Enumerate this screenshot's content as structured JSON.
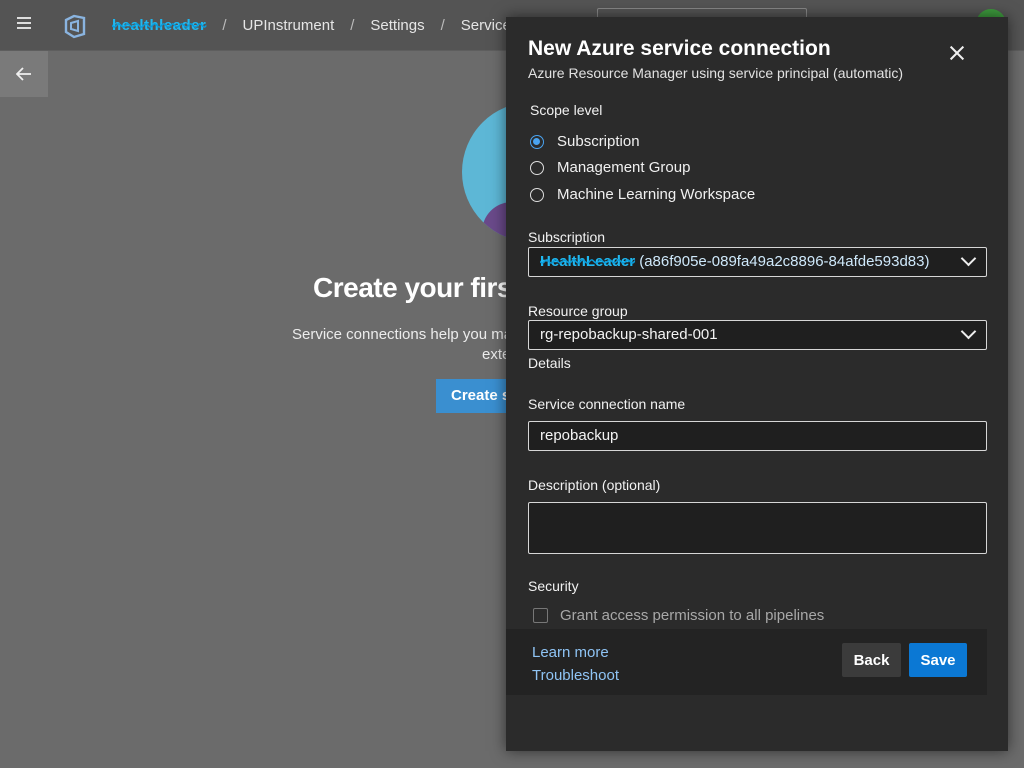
{
  "topbar": {
    "org": "healthleader",
    "project": "UPInstrument",
    "settings": "Settings",
    "service_crumb": "Service c"
  },
  "background": {
    "title": "Create your firs",
    "desc_line1": "Service connections help you mar",
    "desc_line2": "exte",
    "create_button": "Create s"
  },
  "panel": {
    "title": "New Azure service connection",
    "subtitle": "Azure Resource Manager using service principal (automatic)",
    "scope_label": "Scope level",
    "scope_options": [
      "Subscription",
      "Management Group",
      "Machine Learning Workspace"
    ],
    "scope_selected": "Subscription",
    "subscription_label": "Subscription",
    "subscription_name": "HealthLeader",
    "subscription_id": "(a86f905e-089fa49a2c8896-84afde593d83)",
    "resource_group_label": "Resource group",
    "resource_group_value": "rg-repobackup-shared-001",
    "details_label": "Details",
    "connection_name_label": "Service connection name",
    "connection_name_value": "repobackup",
    "description_label": "Description (optional)",
    "description_value": "",
    "security_label": "Security",
    "grant_access_label": "Grant access permission to all pipelines",
    "grant_access_checked": false,
    "learn_more": "Learn more",
    "troubleshoot": "Troubleshoot",
    "back_button": "Back",
    "save_button": "Save"
  },
  "colors": {
    "accent": "#0b78d4",
    "link": "#8fc4f5",
    "panel_bg": "#2b2b2b",
    "overlay_bg": "#6b6b6b"
  },
  "icons": [
    "hamburger-icon",
    "azure-devops-logo",
    "arrow-left-icon",
    "close-icon",
    "chevron-down-icon"
  ]
}
